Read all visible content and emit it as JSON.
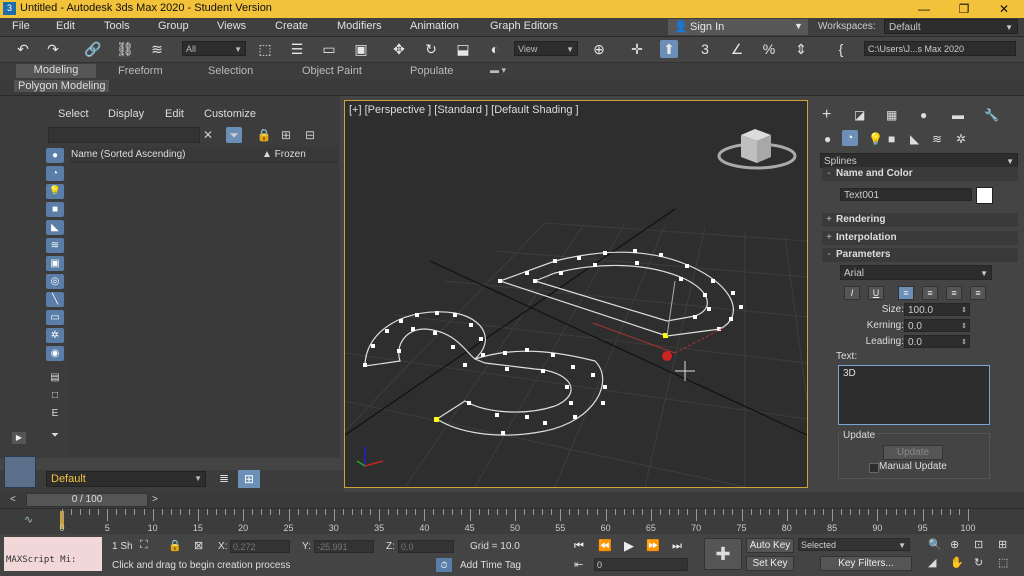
{
  "window": {
    "title": "Untitled - Autodesk 3ds Max 2020 - Student Version",
    "app_icon": "3"
  },
  "menu": [
    "File",
    "Edit",
    "Tools",
    "Group",
    "Views",
    "Create",
    "Modifiers",
    "Animation",
    "Graph Editors"
  ],
  "signin": {
    "label": "Sign In"
  },
  "workspaces": {
    "label": "Workspaces:",
    "value": "Default"
  },
  "toolbar": {
    "filter_value": "All",
    "view_value": "View",
    "path_value": "C:\\Users\\J...s Max 2020"
  },
  "ribbon": {
    "tabs": [
      "Modeling",
      "Freeform",
      "Selection",
      "Object Paint",
      "Populate"
    ],
    "active_panel": "Polygon Modeling"
  },
  "scene_explorer": {
    "menus": [
      "Select",
      "Display",
      "Edit",
      "Customize"
    ],
    "column_name": "Name (Sorted Ascending)",
    "column_frozen": "▲ Frozen"
  },
  "layer": {
    "value": "Default"
  },
  "viewport": {
    "label": "[+] [Perspective ] [Standard ] [Default Shading ]"
  },
  "command_panel": {
    "category": "Splines",
    "rollouts": {
      "name_color": "Name and Color",
      "rendering": "Rendering",
      "interpolation": "Interpolation",
      "parameters": "Parameters"
    },
    "object_name": "Text001",
    "font": "Arial",
    "size_label": "Size:",
    "size_value": "100.0",
    "kerning_label": "Kerning:",
    "kerning_value": "0.0",
    "leading_label": "Leading:",
    "leading_value": "0.0",
    "text_label": "Text:",
    "text_value": "3D",
    "update_group": "Update",
    "update_button": "Update",
    "manual_update": "Manual Update"
  },
  "timeline": {
    "frame_display": "0 / 100",
    "ticks": [
      0,
      5,
      10,
      15,
      20,
      25,
      30,
      35,
      40,
      45,
      50,
      55,
      60,
      65,
      70,
      75,
      80,
      85,
      90,
      95,
      100
    ]
  },
  "status": {
    "maxscript": "MAXScript Mi:",
    "selection_count": "1 Sh",
    "x_label": "X:",
    "x_value": "0.272",
    "y_label": "Y:",
    "y_value": "-25.991",
    "z_label": "Z:",
    "z_value": "0.0",
    "grid": "Grid = 10.0",
    "prompt": "Click and drag to begin creation process",
    "add_time_tag": "Add Time Tag",
    "auto_key": "Auto Key",
    "selected": "Selected",
    "set_key": "Set Key",
    "key_filters": "Key Filters...",
    "frame_value": "0"
  }
}
